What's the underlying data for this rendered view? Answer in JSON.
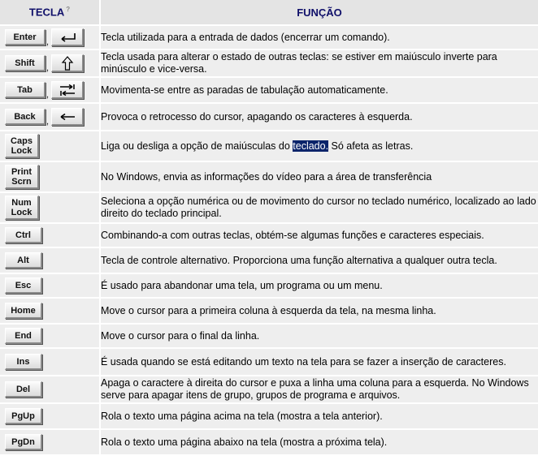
{
  "header": {
    "key_col": "TECLA",
    "key_col_mark": "?",
    "func_col": "FUNÇÃO"
  },
  "rows": [
    {
      "key": "Enter",
      "icon": "enter-arrow-icon",
      "desc": "Tecla utilizada para a entrada de dados (encerrar um comando)."
    },
    {
      "key": "Shift",
      "icon": "shift-arrow-icon",
      "desc": "Tecla usada para alterar o estado de outras teclas: se estiver em maiúsculo inverte para minúsculo e vice-versa."
    },
    {
      "key": "Tab",
      "icon": "tab-arrows-icon",
      "desc": "Movimenta-se entre as paradas de tabulação automaticamente."
    },
    {
      "key": "Back",
      "icon": "backspace-arrow-icon",
      "desc": "Provoca o retrocesso do cursor, apagando os caracteres à esquerda."
    },
    {
      "key_line1": "Caps",
      "key_line2": "Lock",
      "desc_pre": "Liga ou desliga a opção de maiúsculas do ",
      "desc_hl": "teclado.",
      "desc_post": " Só afeta as letras."
    },
    {
      "key_line1": "Print",
      "key_line2": "Scrn",
      "desc": "No Windows, envia as informações do vídeo para a área de transferência"
    },
    {
      "key_line1": "Num",
      "key_line2": "Lock",
      "desc": "Seleciona a opção numérica ou de movimento do cursor no teclado numérico, localizado ao lado direito do teclado principal."
    },
    {
      "key": "Ctrl",
      "desc": "Combinando-a com outras teclas, obtém-se algumas funções e caracteres especiais."
    },
    {
      "key": "Alt",
      "desc": "Tecla de controle alternativo. Proporciona uma função alternativa a qualquer outra tecla."
    },
    {
      "key": "Esc",
      "desc": "É usado para abandonar uma tela, um programa ou um menu."
    },
    {
      "key": "Home",
      "desc": "Move o cursor para a primeira coluna à esquerda da tela, na mesma linha."
    },
    {
      "key": "End",
      "desc": "Move o cursor para o final da linha."
    },
    {
      "key": "Ins",
      "desc": "É usada quando se está editando um texto na tela para se fazer a inserção de caracteres."
    },
    {
      "key": "Del",
      "desc": "Apaga o caractere à direita do cursor e puxa a linha uma coluna para a esquerda. No Windows serve para apagar itens de grupo, grupos de programa e arquivos."
    },
    {
      "key": "PgUp",
      "desc": "Rola o texto uma página acima na tela (mostra a tela anterior)."
    },
    {
      "key": "PgDn",
      "desc": "Rola o texto uma página abaixo na tela (mostra a próxima tela)."
    }
  ],
  "separator": ","
}
